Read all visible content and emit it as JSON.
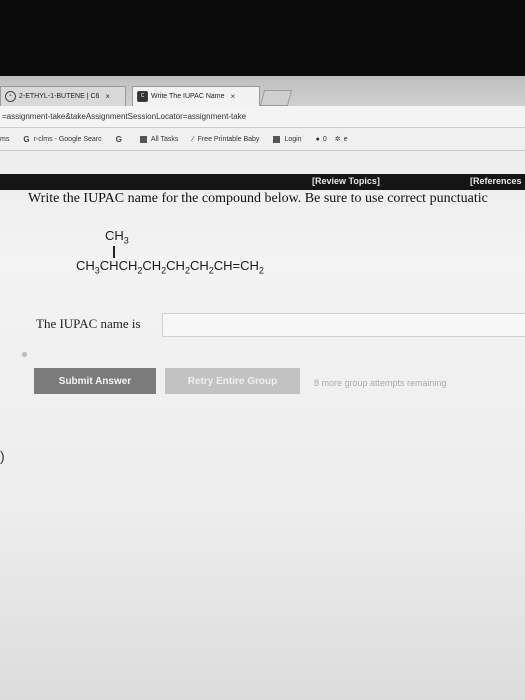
{
  "browser": {
    "tabs": [
      {
        "label": "2-ETHYL-1-BUTENE | C6",
        "close": "×",
        "icon": "molecule-icon"
      },
      {
        "label": "Write The IUPAC Name",
        "close": "×",
        "icon": "c-logo-icon"
      }
    ],
    "url": "=assignment-take&takeAssignmentSessionLocator=assignment-take",
    "bookmarks": [
      {
        "label": "ms"
      },
      {
        "label": "r-clms - Google Searc",
        "prefix": "G"
      },
      {
        "label": "G"
      },
      {
        "label": "All Tasks"
      },
      {
        "label": "Free Printable Baby"
      },
      {
        "label": "Login"
      },
      {
        "label": "0"
      },
      {
        "label": "e"
      }
    ]
  },
  "topics": {
    "review": "[Review Topics]",
    "references": "[References"
  },
  "question": {
    "text": "Write the IUPAC name for the compound below. Be sure to use correct punctuatic",
    "branch": "CH3",
    "chain": "CH3CHCH2CH2CH2CH2CH=CH2"
  },
  "answer": {
    "prompt": "The IUPAC name is",
    "value": "",
    "placeholder": ""
  },
  "actions": {
    "submit": "Submit Answer",
    "retry": "Retry Entire Group",
    "remaining": "8 more group attempts remaining"
  }
}
